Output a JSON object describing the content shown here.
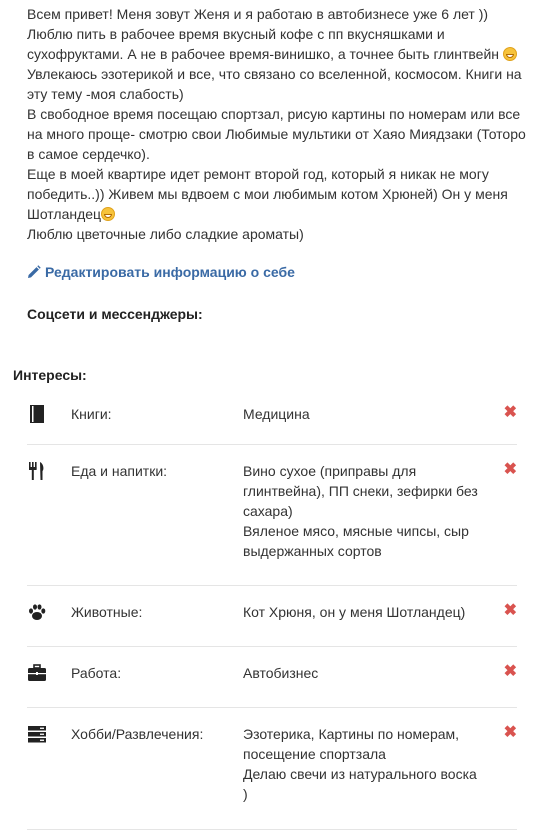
{
  "about": {
    "lines": [
      "Всем привет! Меня зовут Женя и я работаю в автобизнесе уже 6 лет ))",
      "Люблю пить в рабочее время вкусный кофе с пп вкусняшками и сухофруктами. А не в рабочее время-винишко, а точнее быть глинтвейн",
      "Увлекаюсь эзотерикой и все, что связано со вселенной, космосом. Книги на эту тему -моя слабость)",
      "В свободное время посещаю спортзал, рисую картины по номерам или все на много проще- смотрю свои Любимые мультики от Хаяо Миядзаки (Тоторо в самое сердечко).",
      "Еще в моей квартире идет ремонт второй год, который я никак не могу победить..)) Живем мы вдвоем с мои любимым котом Хрюней) Он у меня Шотландец",
      "Люблю цветочные либо сладкие ароматы)"
    ]
  },
  "edit_link": "Редактировать информацию о себе",
  "social_title": "Соцсети и мессенджеры:",
  "interests_title": "Интересы:",
  "interests": [
    {
      "icon": "book-icon",
      "label": "Книги:",
      "value": [
        "Медицина"
      ]
    },
    {
      "icon": "fork-knife-icon",
      "label": "Еда и напитки:",
      "value": [
        "Вино сухое (приправы для глинтвейна), ПП снеки, зефирки без сахара)",
        "Вяленое мясо, мясные чипсы, сыр выдержанных сортов"
      ]
    },
    {
      "icon": "paw-icon",
      "label": "Животные:",
      "value": [
        "Кот Хрюня, он у меня Шотландец)"
      ]
    },
    {
      "icon": "briefcase-icon",
      "label": "Работа:",
      "value": [
        "Автобизнес"
      ]
    },
    {
      "icon": "server-icon",
      "label": "Хобби/Развлечения:",
      "value": [
        "Эзотерика, Картины по номерам, посещение спортзала",
        "Делаю свечи из натурального воска )"
      ]
    }
  ],
  "delete_glyph": "✖",
  "colors": {
    "link": "#3a6aa5",
    "delete": "#d9534f",
    "divider": "#e5e5e5"
  }
}
